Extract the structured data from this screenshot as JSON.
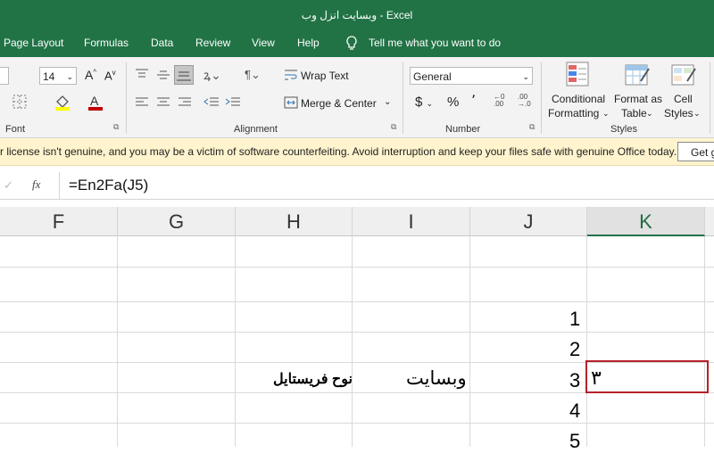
{
  "window": {
    "title": "وبسایت انزل وب  -  Excel"
  },
  "tabs": [
    "Page Layout",
    "Formulas",
    "Data",
    "Review",
    "View",
    "Help"
  ],
  "tell_me": "Tell me what you want to do",
  "ribbon": {
    "font": {
      "size": "14",
      "group_label": "Font"
    },
    "alignment": {
      "wrap_text": "Wrap Text",
      "merge_center": "Merge & Center",
      "group_label": "Alignment"
    },
    "number": {
      "format": "General",
      "percent": "%",
      "comma": "٬",
      "group_label": "Number"
    },
    "styles": {
      "conditional_1": "Conditional",
      "conditional_2": "Formatting",
      "format_table_1": "Format as",
      "format_table_2": "Table",
      "cell_styles_1": "Cell",
      "cell_styles_2": "Styles",
      "group_label": "Styles"
    }
  },
  "license_bar": {
    "message": "r license isn't genuine, and you may be a victim of software counterfeiting. Avoid interruption and keep your files safe with genuine Office today.",
    "button": "Get g"
  },
  "formula_bar": {
    "fx": "fx",
    "formula": "=En2Fa(J5)"
  },
  "columns": [
    "F",
    "G",
    "H",
    "I",
    "J",
    "K"
  ],
  "selected_column": "K",
  "cells": {
    "j_values": [
      "1",
      "2",
      "3",
      "4",
      "5"
    ],
    "h3": "نوح فریستایل",
    "i3": "وبسایت",
    "k3": "٣"
  },
  "colors": {
    "accent": "#217346",
    "selection": "#b5222b",
    "warning_bg": "#fff4ce"
  }
}
